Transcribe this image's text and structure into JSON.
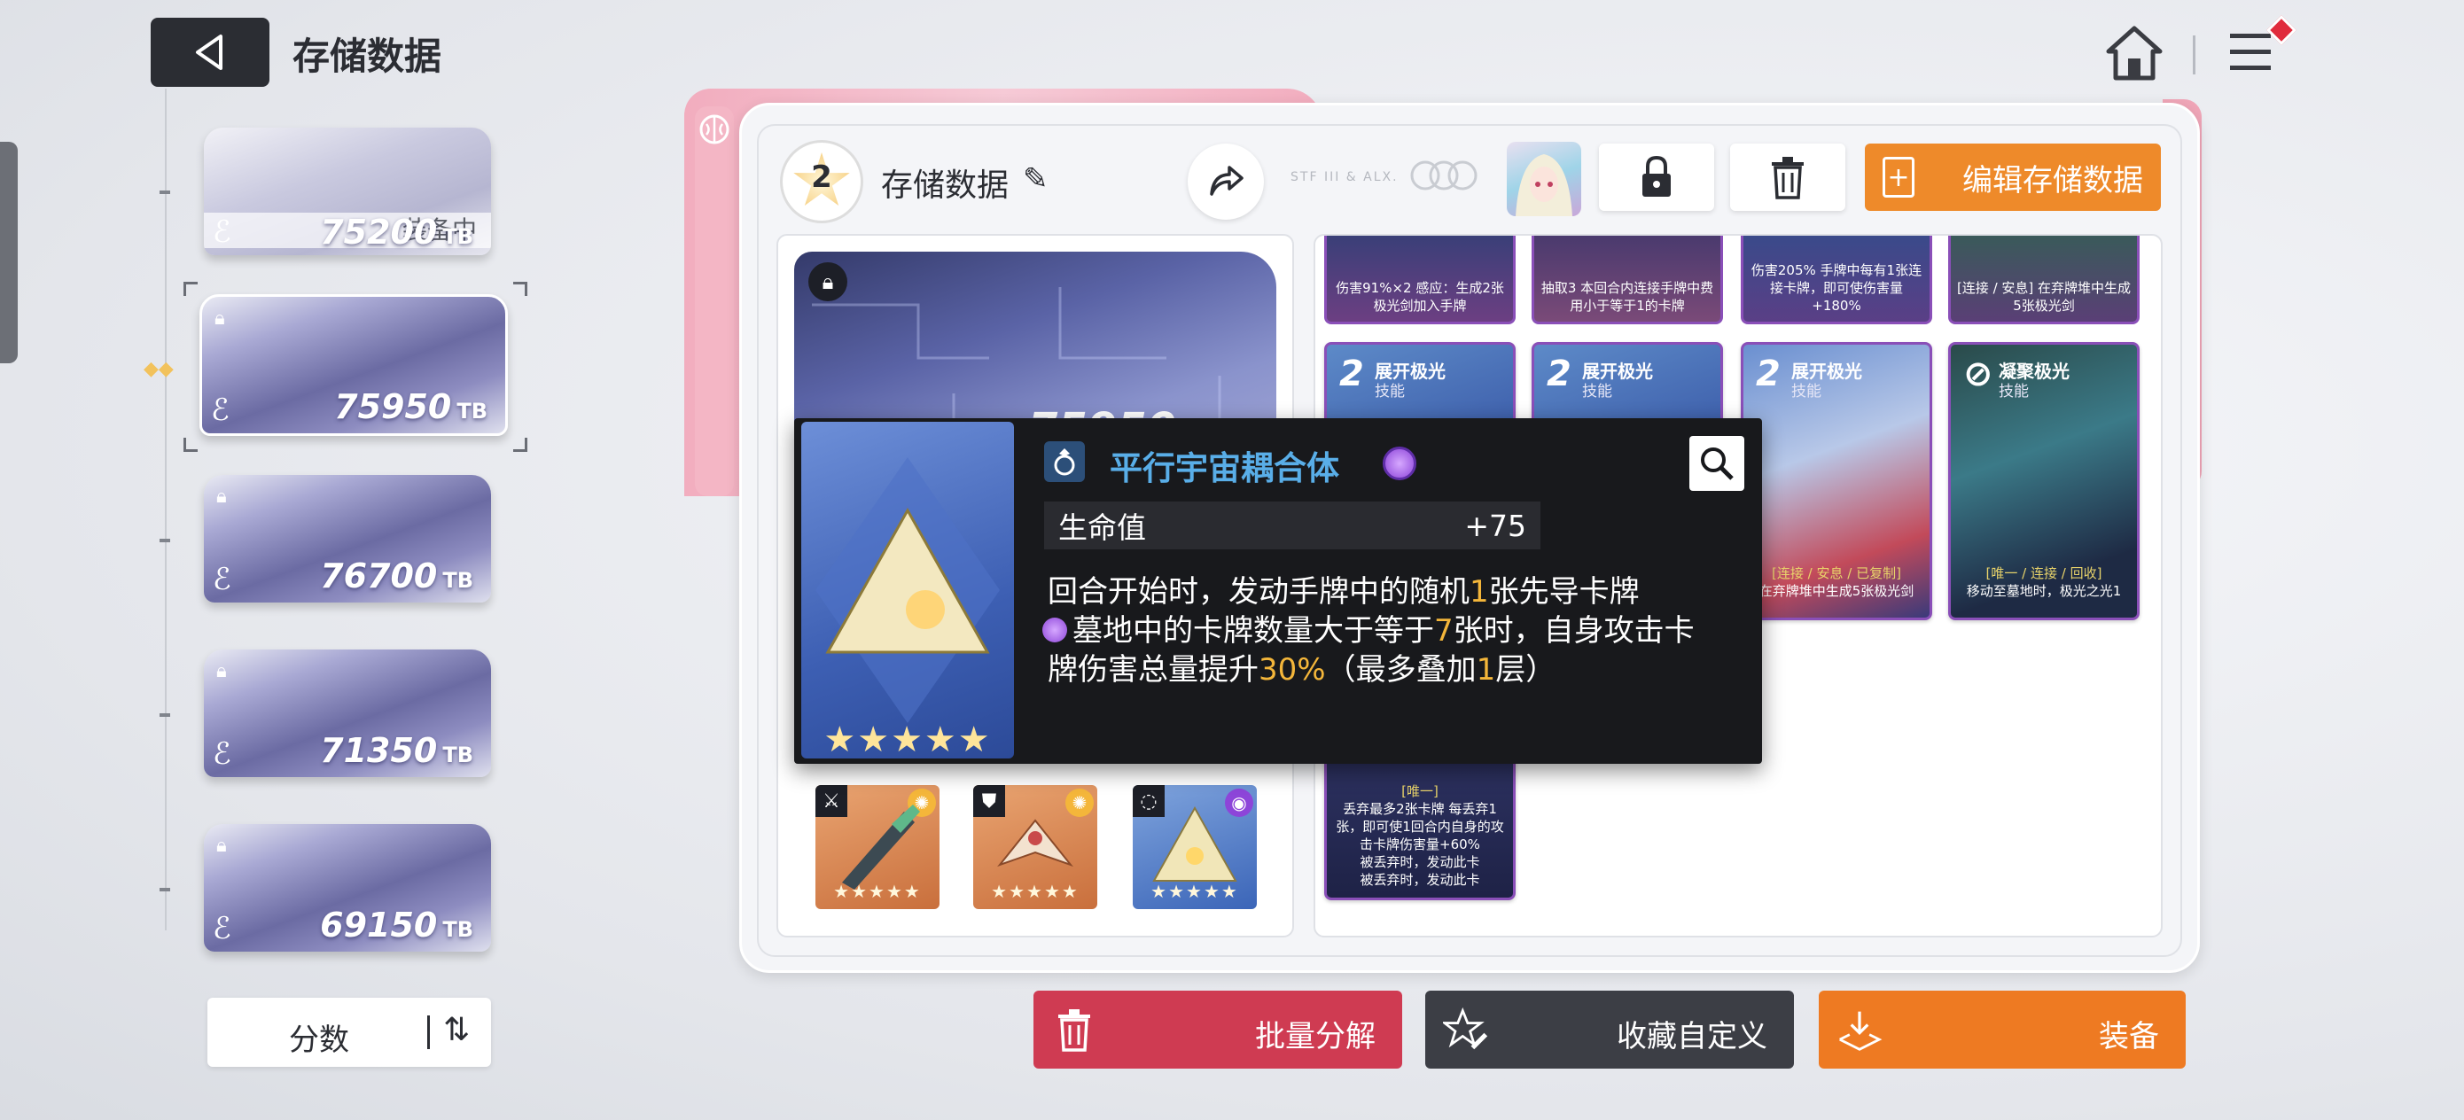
{
  "header": {
    "back_icon": "back-triangle-icon",
    "title": "存储数据",
    "home_icon": "home-icon",
    "menu_icon": "menu-icon"
  },
  "slots": [
    {
      "value": "75200",
      "unit": "TB",
      "status": "装备中",
      "locked": false,
      "selected": false
    },
    {
      "value": "75950",
      "unit": "TB",
      "status": "",
      "locked": true,
      "selected": true
    },
    {
      "value": "76700",
      "unit": "TB",
      "status": "",
      "locked": true,
      "selected": false
    },
    {
      "value": "71350",
      "unit": "TB",
      "status": "",
      "locked": true,
      "selected": false
    },
    {
      "value": "69150",
      "unit": "TB",
      "status": "",
      "locked": true,
      "selected": false
    }
  ],
  "sort": {
    "label": "分数",
    "icon": "sort-arrows-icon"
  },
  "panel": {
    "level": "2",
    "name": "存储数据",
    "edit_label": "编辑存储数据",
    "faint_text": "STF III & ALX.",
    "big_card_value": "75950"
  },
  "equipment": [
    {
      "type_icon": "sword-icon",
      "gem_color": "#f4b63a",
      "stars": "★★★★★"
    },
    {
      "type_icon": "armor-icon",
      "gem_color": "#f4b63a",
      "stars": "★★★★★"
    },
    {
      "type_icon": "ring-icon",
      "gem_color": "#8d45d9",
      "stars": "★★★★★"
    }
  ],
  "top_cards": [
    {
      "desc": "伤害91%×2 感应：生成2张极光剑加入手牌"
    },
    {
      "desc": "抽取3 本回合内连接手牌中费用小于等于1的卡牌"
    },
    {
      "desc": "伤害205% 手牌中每有1张连接卡牌，即可使伤害量+180%"
    },
    {
      "desc": "[连接 / 安息] 在弃牌堆中生成5张极光剑"
    }
  ],
  "cards": [
    {
      "cost": "2",
      "title": "展开极光",
      "sub": "技能",
      "tag": "",
      "desc": ""
    },
    {
      "cost": "2",
      "title": "展开极光",
      "sub": "技能",
      "tag": "",
      "desc": ""
    },
    {
      "cost": "2",
      "title": "展开极光",
      "sub": "技能",
      "tag": "[连接 / 安息 / 已复制]",
      "desc": "在弃牌堆中生成5张极光剑"
    },
    {
      "cost": "⊘",
      "title": "凝聚极光",
      "sub": "技能",
      "tag": "[唯一 / 连接 / 回收]",
      "desc": "移动至墓地时，极光之光1"
    }
  ],
  "bottom_card": {
    "tag": "[唯一]",
    "desc": "丢弃最多2张卡牌 每丢弃1张，即可使1回合内自身的攻击卡牌伤害量+60%",
    "line2": "被丢弃时，发动此卡",
    "line3": "被丢弃时，发动此卡"
  },
  "tooltip": {
    "title": "平行宇宙耦合体",
    "stars": "★★★★★",
    "stat_name": "生命值",
    "stat_value": "+75",
    "line1_a": "回合开始时，发动手牌中的随机",
    "line1_n": "1",
    "line1_b": "张先导卡牌",
    "line2_a": "墓地中的卡牌数量大于等于",
    "line2_n": "7",
    "line2_b": "张时，自身攻击卡",
    "line3_a": "牌伤害总量提升",
    "line3_n": "30%",
    "line3_b": "（最多叠加",
    "line3_n2": "1",
    "line3_c": "层）"
  },
  "buttons": {
    "decompose": "批量分解",
    "collect": "收藏自定义",
    "equip": "装备"
  }
}
